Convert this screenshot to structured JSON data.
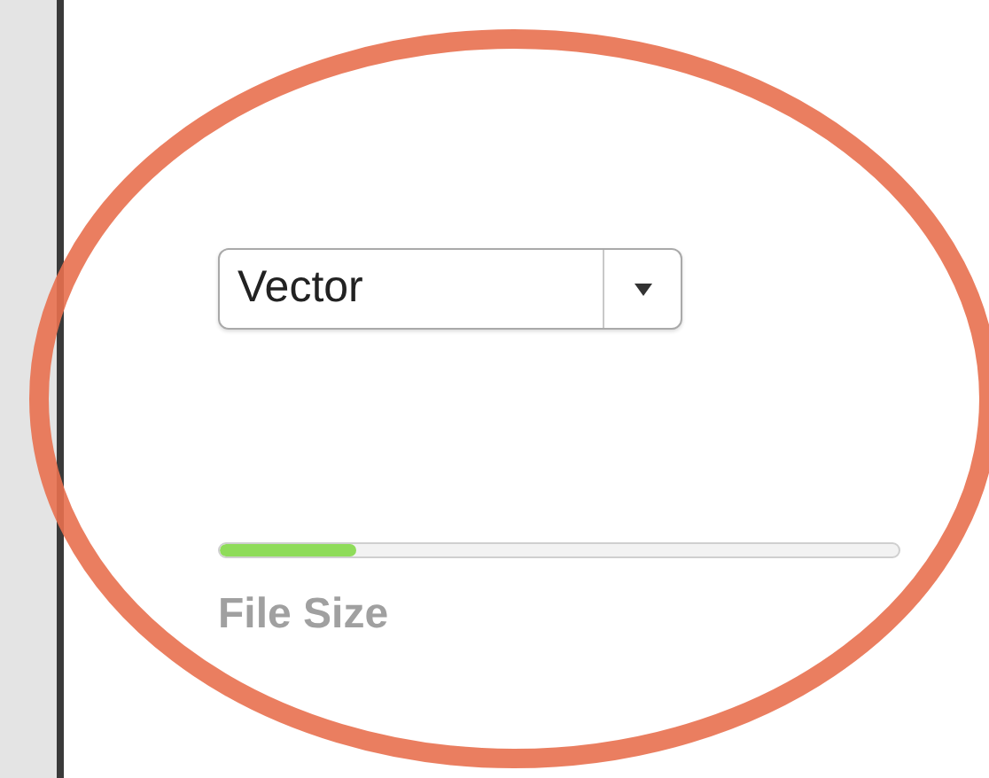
{
  "dropdown": {
    "value": "Vector"
  },
  "file_size": {
    "label": "File Size",
    "level": 0.2
  }
}
